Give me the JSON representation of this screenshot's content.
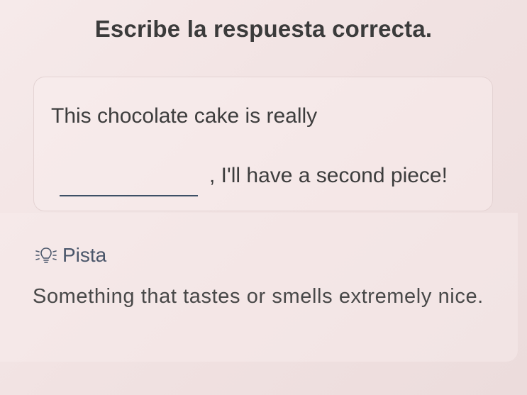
{
  "exercise": {
    "instruction": "Escribe la respuesta correcta.",
    "sentence_part1": "This chocolate cake is really",
    "sentence_part2": ", I'll have a second piece!",
    "answer_value": ""
  },
  "hint": {
    "icon": "lightbulb-icon",
    "label": "Pista",
    "text": "Something that tastes or smells extremely nice."
  },
  "colors": {
    "background": "#f3e6e6",
    "text": "#3d3d3d",
    "underline": "#3d5066",
    "hint_label": "#4a566a"
  }
}
